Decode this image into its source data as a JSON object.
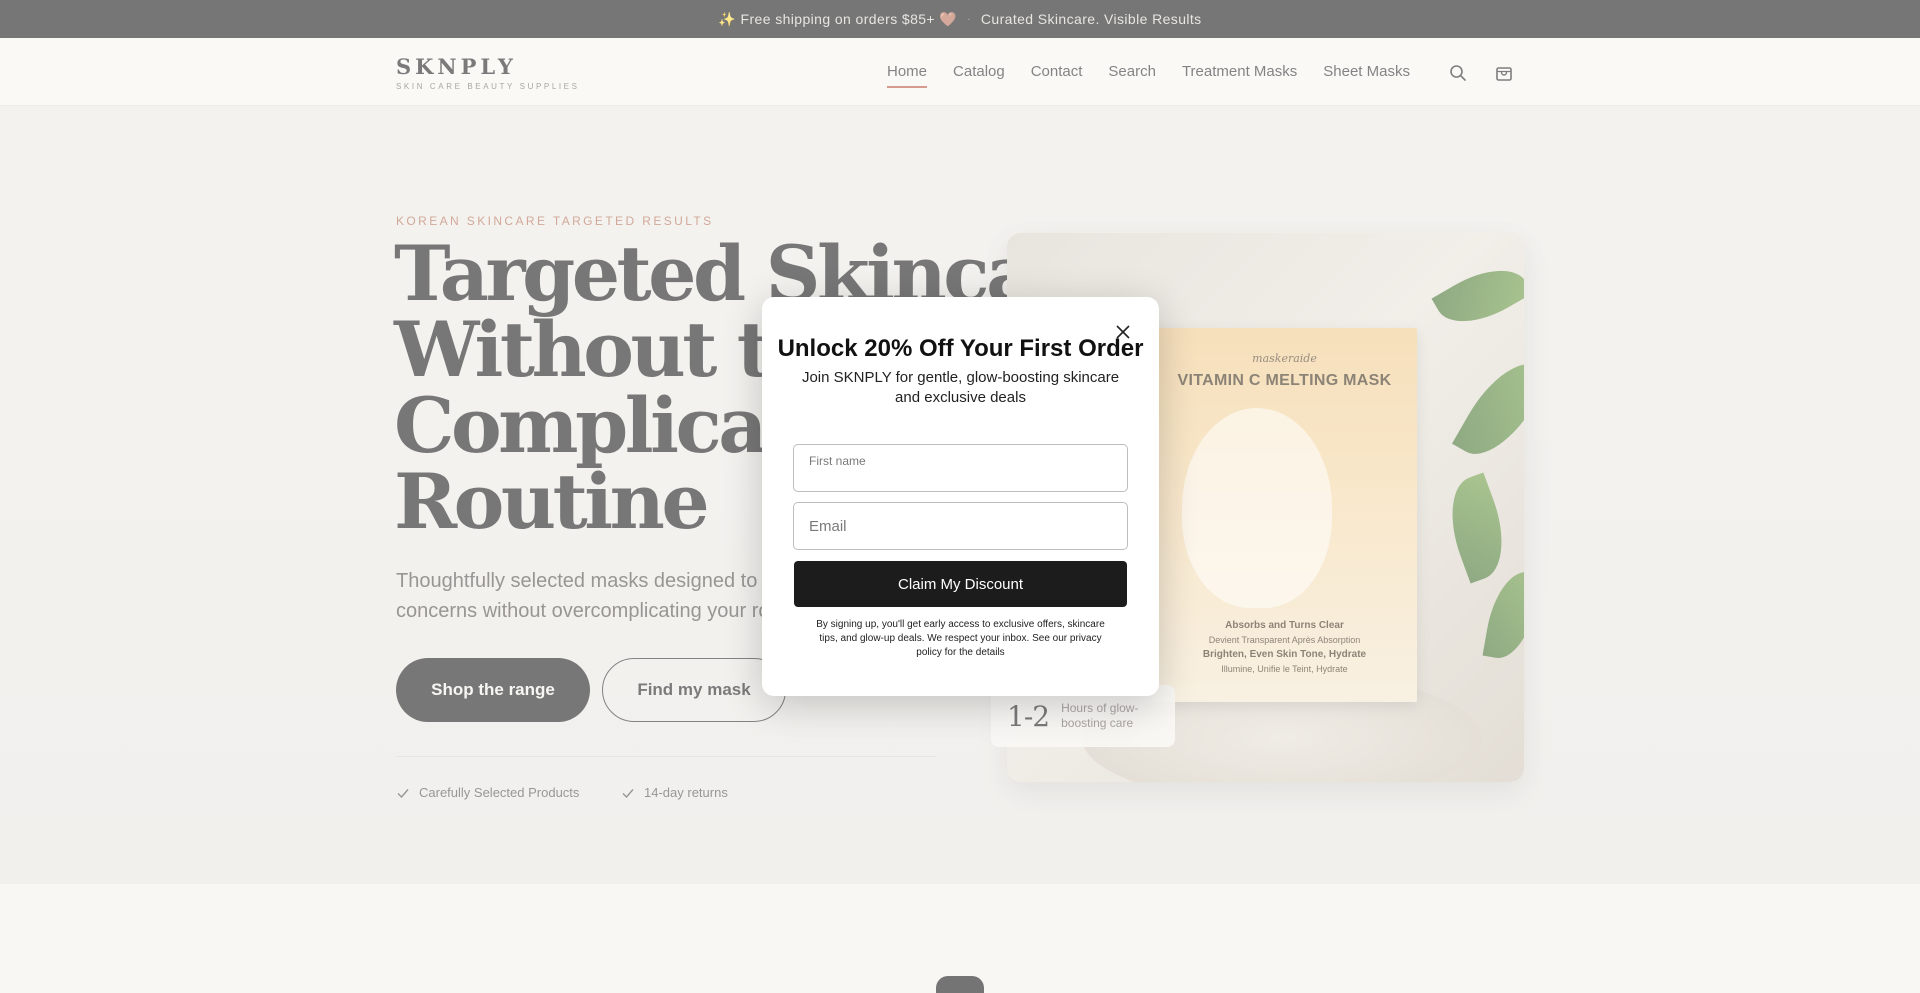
{
  "announcement": {
    "shipping_text": "✨ Free shipping on orders $85+ 🤎",
    "separator": "·",
    "tagline": "Curated Skincare. Visible Results"
  },
  "header": {
    "brand": "SKNPLY",
    "brand_tagline": "SKIN CARE BEAUTY SUPPLIES",
    "nav": [
      {
        "label": "Home",
        "active": true
      },
      {
        "label": "Catalog"
      },
      {
        "label": "Contact"
      },
      {
        "label": "Search"
      },
      {
        "label": "Treatment Masks"
      },
      {
        "label": "Sheet Masks"
      }
    ],
    "icons": [
      "search-icon",
      "cart-icon"
    ]
  },
  "hero": {
    "eyebrow": "KOREAN SKINCARE TARGETED RESULTS",
    "headline": [
      "Targeted Skincare",
      "Without the",
      "Complicated",
      "Routine"
    ],
    "subtext": "Thoughtfully selected masks designed to target concerns without overcomplicating your routine",
    "primary_cta": "Shop the range",
    "secondary_cta": "Find my mask",
    "trust": [
      "Carefully Selected Products",
      "14-day returns"
    ]
  },
  "product": {
    "brand": "maskeraide",
    "title": "VITAMIN C MELTING MASK",
    "lines": [
      "Absorbs and Turns Clear",
      "Devient Transparent Après Absorption",
      "Brighten, Even Skin Tone, Hydrate",
      "Illumine, Unifie le Teint, Hydrate"
    ],
    "stat_value": "1-2",
    "stat_label": "Hours of glow-boosting care"
  },
  "modal": {
    "title": "Unlock 20% Off Your First Order",
    "subtitle": "Join SKNPLY for gentle, glow-boosting skincare and exclusive deals",
    "first_name_label": "First name",
    "first_name_value": "",
    "email_placeholder": "Email",
    "email_value": "",
    "submit_label": "Claim My Discount",
    "fineprint": "By signing up, you'll get early access to exclusive offers, skincare tips, and glow-up deals. We respect your inbox. See our privacy policy for the details"
  },
  "colors": {
    "accent": "#b9513d",
    "dark": "#161616",
    "eyebrow": "#b06a4e"
  }
}
